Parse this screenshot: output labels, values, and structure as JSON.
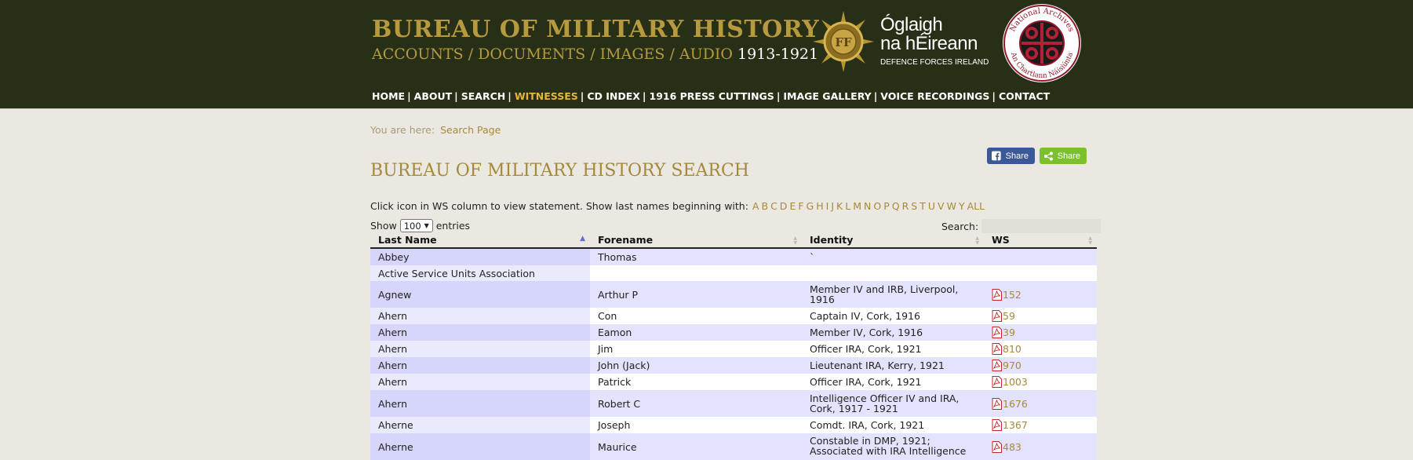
{
  "header": {
    "site_title": "BUREAU OF MILITARY HISTORY",
    "site_subtitle": "ACCOUNTS / DOCUMENTS / IMAGES / AUDIO",
    "site_years": "1913-1921",
    "dfi_name_line1": "Óglaigh",
    "dfi_name_line2": "na hÉireann",
    "dfi_sub": "DEFENCE FORCES IRELAND",
    "na_seal_top": "National Archives",
    "na_seal_bottom": "An Chartlann Náisiúnta"
  },
  "nav": {
    "items": [
      "HOME",
      "ABOUT",
      "SEARCH",
      "WITNESSES",
      "CD INDEX",
      "1916 PRESS CUTTINGS",
      "IMAGE GALLERY",
      "VOICE RECORDINGS",
      "CONTACT"
    ],
    "active": "WITNESSES",
    "active_color": "#e8b53a"
  },
  "breadcrumb": {
    "label": "You are here:",
    "current": "Search Page"
  },
  "share": {
    "facebook_label": "Share",
    "generic_label": "Share"
  },
  "page_title": "BUREAU OF MILITARY HISTORY SEARCH",
  "intro": {
    "text": "Click icon in WS column to view statement. Show last names beginning with:",
    "letters": [
      "A",
      "B",
      "C",
      "D",
      "E",
      "F",
      "G",
      "H",
      "I",
      "J",
      "K",
      "L",
      "M",
      "N",
      "O",
      "P",
      "Q",
      "R",
      "S",
      "T",
      "U",
      "V",
      "W",
      "Y",
      "ALL"
    ]
  },
  "controls": {
    "show_label": "Show",
    "entries_value": "100",
    "entries_label": "entries",
    "search_label": "Search:"
  },
  "table": {
    "columns": [
      "Last Name",
      "Forename",
      "Identity",
      "WS"
    ],
    "sorted_column": "Last Name",
    "rows": [
      {
        "last": "Abbey",
        "fore": "Thomas",
        "identity": "`",
        "ws": ""
      },
      {
        "last": "Active Service Units Association",
        "fore": "",
        "identity": "",
        "ws": ""
      },
      {
        "last": "Agnew",
        "fore": "Arthur P",
        "identity": "Member IV and IRB, Liverpool, 1916",
        "ws": "152"
      },
      {
        "last": "Ahern",
        "fore": "Con",
        "identity": "Captain IV, Cork, 1916",
        "ws": "59"
      },
      {
        "last": "Ahern",
        "fore": "Eamon",
        "identity": "Member IV, Cork, 1916",
        "ws": "39"
      },
      {
        "last": "Ahern",
        "fore": "Jim",
        "identity": "Officer IRA, Cork, 1921",
        "ws": "810"
      },
      {
        "last": "Ahern",
        "fore": "John (Jack)",
        "identity": "Lieutenant IRA, Kerry, 1921",
        "ws": "970"
      },
      {
        "last": "Ahern",
        "fore": "Patrick",
        "identity": "Officer IRA, Cork, 1921",
        "ws": "1003"
      },
      {
        "last": "Ahern",
        "fore": "Robert C",
        "identity": "Intelligence Officer IV and IRA, Cork, 1917 - 1921",
        "ws": "1676"
      },
      {
        "last": "Aherne",
        "fore": "Joseph",
        "identity": "Comdt. IRA, Cork, 1921",
        "ws": "1367"
      },
      {
        "last": "Aherne",
        "fore": "Maurice",
        "identity": "Constable in DMP, 1921; Associated with IRA Intelligence",
        "ws": "483"
      }
    ]
  },
  "colors": {
    "header_bg": "#272f17",
    "gold": "#b79a3f",
    "link": "#a5893a",
    "page_bg": "#ebe8e1"
  }
}
